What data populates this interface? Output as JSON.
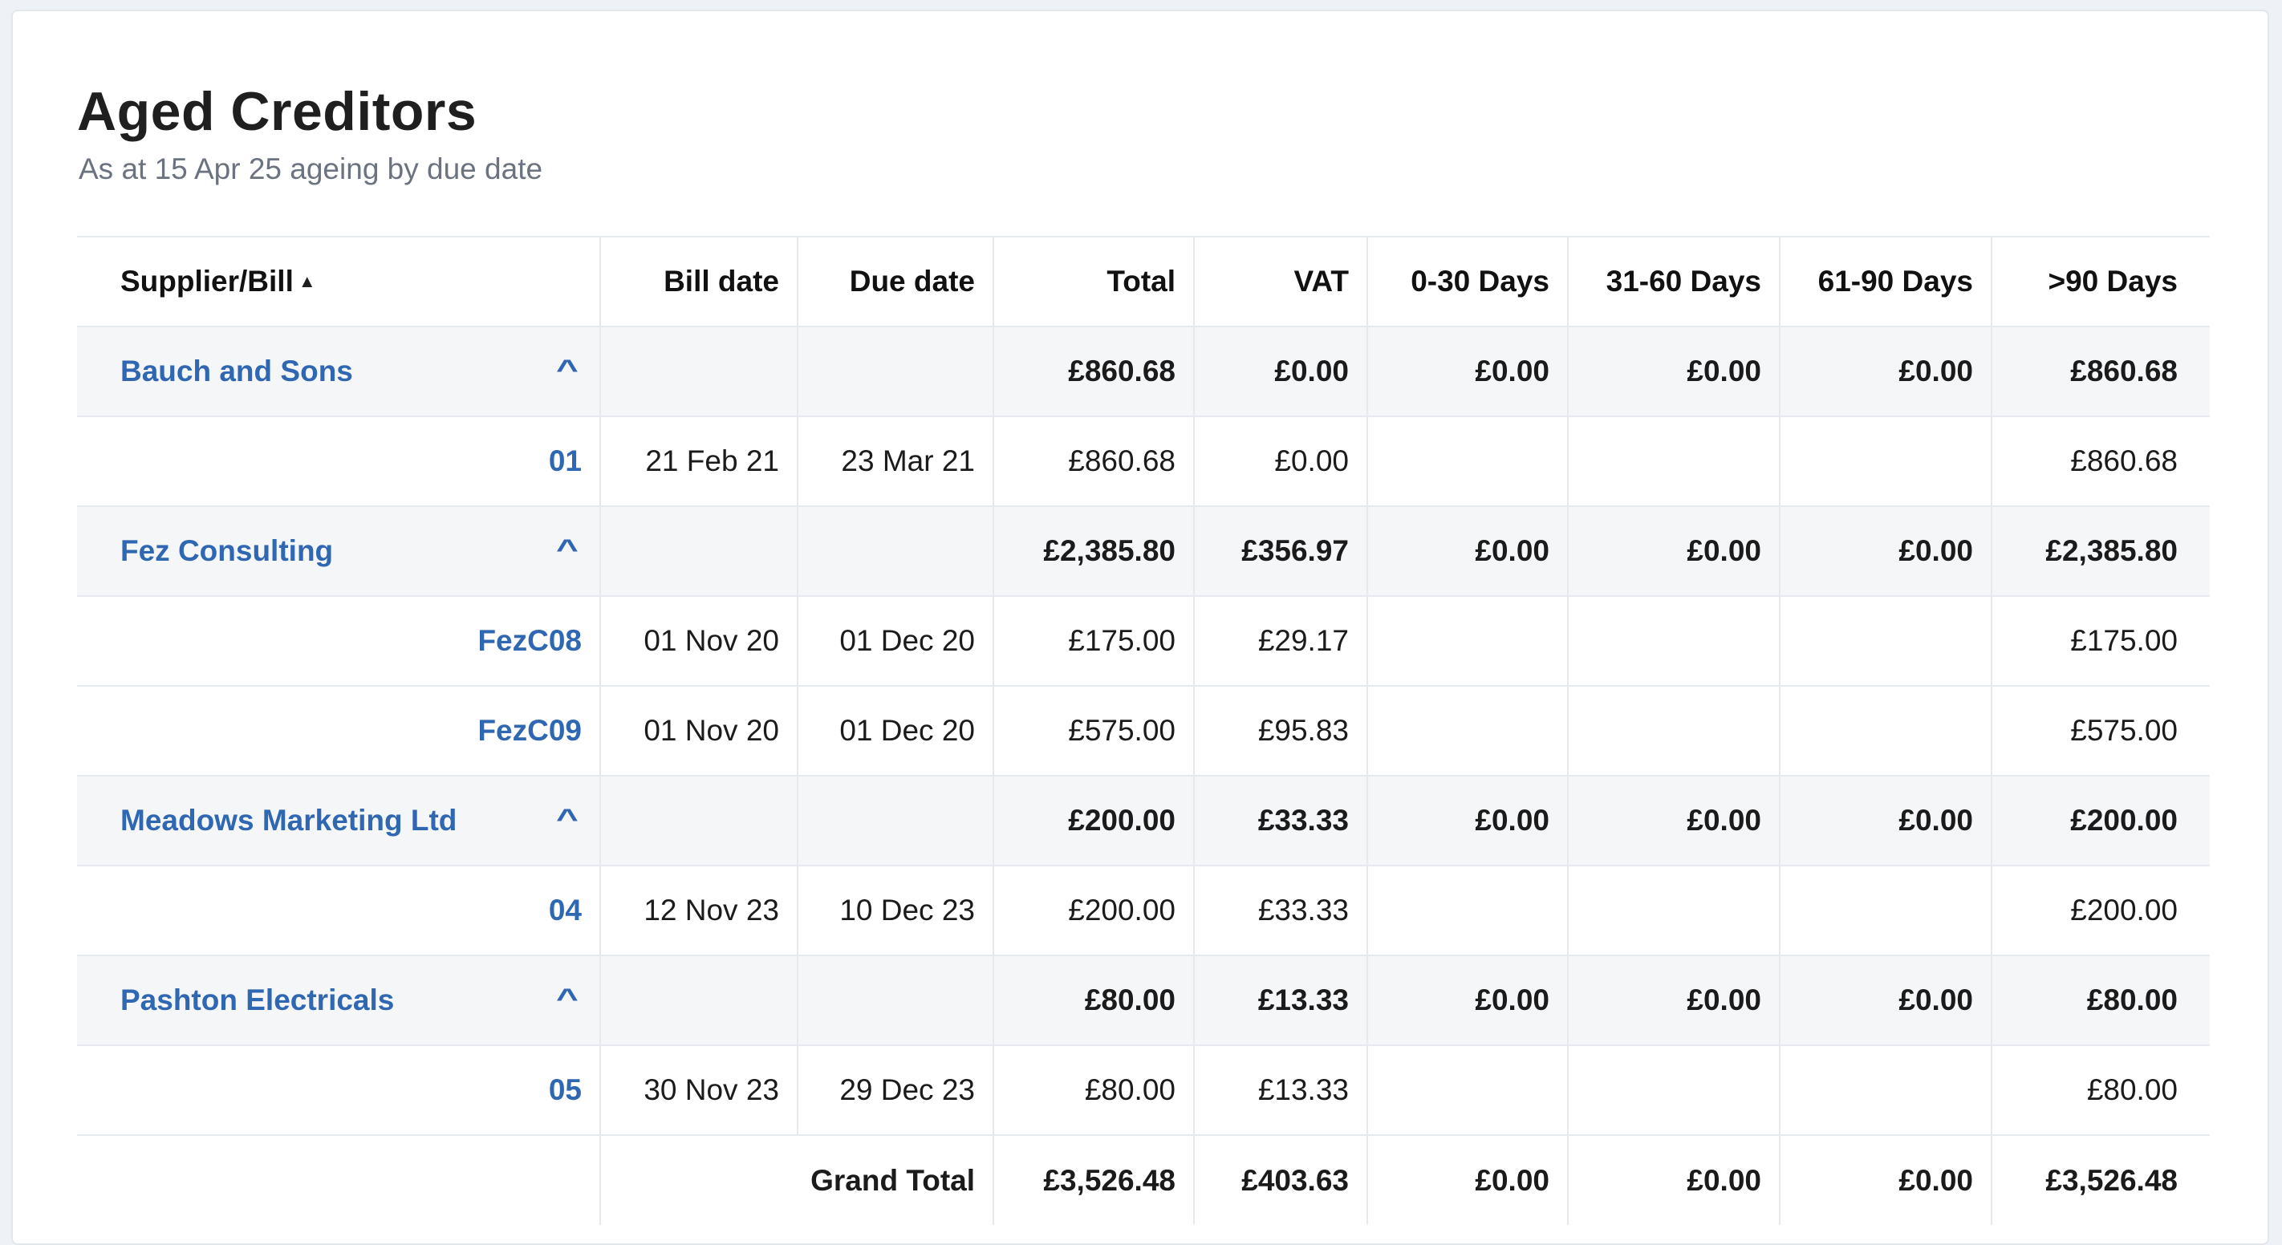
{
  "report": {
    "title": "Aged Creditors",
    "subtitle": "As at 15 Apr 25 ageing by due date"
  },
  "columns": {
    "supplier": "Supplier/Bill",
    "bill_date": "Bill date",
    "due_date": "Due date",
    "total": "Total",
    "vat": "VAT",
    "d0_30": "0-30 Days",
    "d31_60": "31-60 Days",
    "d61_90": "61-90 Days",
    "d90": ">90 Days"
  },
  "icons": {
    "sort": "sort-ascending-icon",
    "collapse": "chevron-up-icon"
  },
  "colors": {
    "link": "#2f67b2",
    "group_row_bg": "#f4f6f8",
    "subtitle": "#6b7280"
  },
  "groups": [
    {
      "name": "Bauch and Sons",
      "total": "£860.68",
      "vat": "£0.00",
      "d0_30": "£0.00",
      "d31_60": "£0.00",
      "d61_90": "£0.00",
      "d90": "£860.68",
      "bills": [
        {
          "ref": "01",
          "bill_date": "21 Feb 21",
          "due_date": "23 Mar 21",
          "total": "£860.68",
          "vat": "£0.00",
          "d0_30": "",
          "d31_60": "",
          "d61_90": "",
          "d90": "£860.68"
        }
      ]
    },
    {
      "name": "Fez Consulting",
      "total": "£2,385.80",
      "vat": "£356.97",
      "d0_30": "£0.00",
      "d31_60": "£0.00",
      "d61_90": "£0.00",
      "d90": "£2,385.80",
      "bills": [
        {
          "ref": "FezC08",
          "bill_date": "01 Nov 20",
          "due_date": "01 Dec 20",
          "total": "£175.00",
          "vat": "£29.17",
          "d0_30": "",
          "d31_60": "",
          "d61_90": "",
          "d90": "£175.00"
        },
        {
          "ref": "FezC09",
          "bill_date": "01 Nov 20",
          "due_date": "01 Dec 20",
          "total": "£575.00",
          "vat": "£95.83",
          "d0_30": "",
          "d31_60": "",
          "d61_90": "",
          "d90": "£575.00"
        }
      ]
    },
    {
      "name": "Meadows Marketing Ltd",
      "total": "£200.00",
      "vat": "£33.33",
      "d0_30": "£0.00",
      "d31_60": "£0.00",
      "d61_90": "£0.00",
      "d90": "£200.00",
      "bills": [
        {
          "ref": "04",
          "bill_date": "12 Nov 23",
          "due_date": "10 Dec 23",
          "total": "£200.00",
          "vat": "£33.33",
          "d0_30": "",
          "d31_60": "",
          "d61_90": "",
          "d90": "£200.00"
        }
      ]
    },
    {
      "name": "Pashton Electricals",
      "total": "£80.00",
      "vat": "£13.33",
      "d0_30": "£0.00",
      "d31_60": "£0.00",
      "d61_90": "£0.00",
      "d90": "£80.00",
      "bills": [
        {
          "ref": "05",
          "bill_date": "30 Nov 23",
          "due_date": "29 Dec 23",
          "total": "£80.00",
          "vat": "£13.33",
          "d0_30": "",
          "d31_60": "",
          "d61_90": "",
          "d90": "£80.00"
        }
      ]
    }
  ],
  "grand_total": {
    "label": "Grand Total",
    "total": "£3,526.48",
    "vat": "£403.63",
    "d0_30": "£0.00",
    "d31_60": "£0.00",
    "d61_90": "£0.00",
    "d90": "£3,526.48"
  }
}
